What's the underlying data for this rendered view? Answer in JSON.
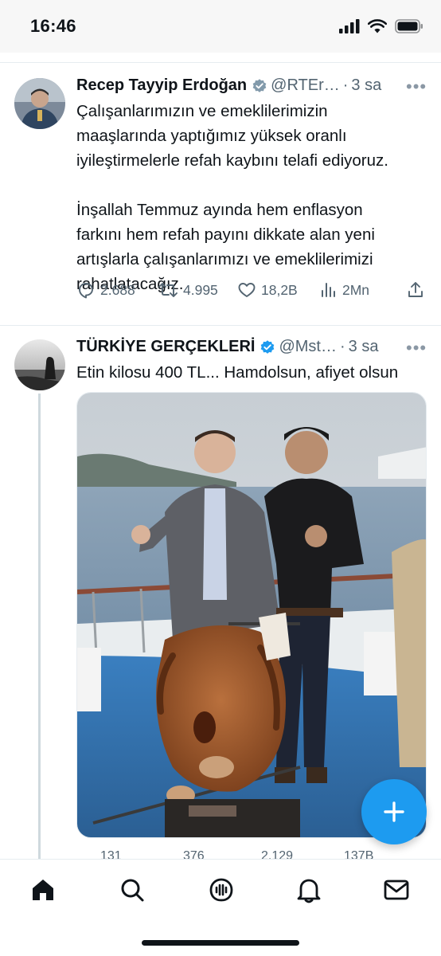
{
  "status_bar": {
    "time": "16:46"
  },
  "tweets": [
    {
      "author": "Recep Tayyip Erdoğan",
      "handle": "@RTEr…",
      "dot": "·",
      "time": "3 sa",
      "more": "•••",
      "text": "Çalışanlarımızın ve emeklilerimizin\nmaaşlarında yaptığımız yüksek oranlı\niyileştirmelerle refah kaybını telafi ediyoruz.\n\nİnşallah Temmuz ayında hem enflasyon\nfarkını hem refah payını dikkate alan yeni\nartışlarla çalışanlarımızı ve emeklilerimizi\nrahatlatacağız.",
      "replies": "2.688",
      "retweets": "4.995",
      "likes": "18,2B",
      "views": "2Mn"
    },
    {
      "author": "TÜRKİYE GERÇEKLERİ",
      "handle": "@Mst…",
      "dot": "·",
      "time": "3 sa",
      "more": "•••",
      "text": "Etin kilosu 400 TL... Hamdolsun, afiyet olsun",
      "replies": "131",
      "retweets": "376",
      "likes": "2.129",
      "views": "137B"
    }
  ],
  "nav": {
    "items": [
      "home-icon",
      "search-icon",
      "spaces-icon",
      "notifications-icon",
      "messages-icon"
    ]
  },
  "colors": {
    "accent": "#1d9bf0",
    "text": "#0f1419",
    "muted": "#536471"
  }
}
